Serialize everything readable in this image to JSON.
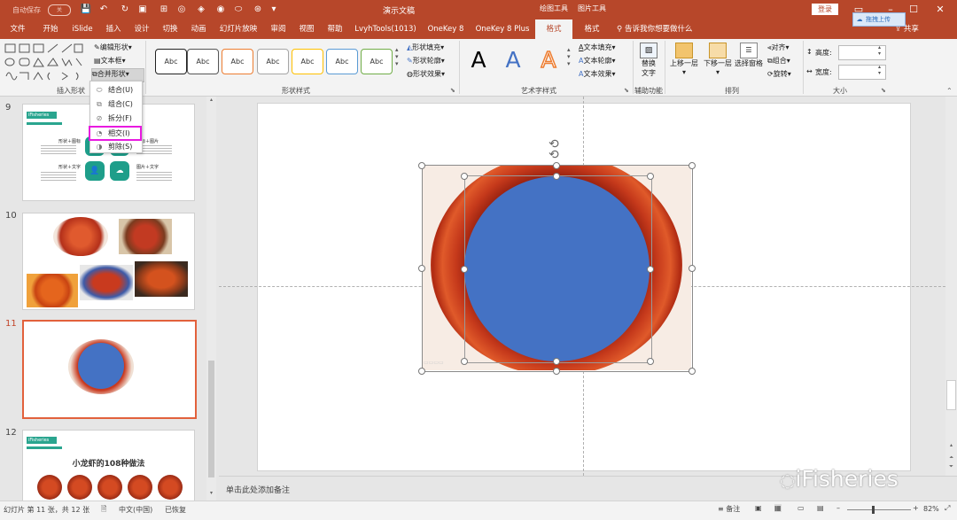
{
  "titlebar": {
    "autosave": "自动保存",
    "autosave_state": "关",
    "doc_title": "演示文稿",
    "ctx_drawing": "绘图工具",
    "ctx_picture": "图片工具",
    "login": "登录",
    "upload": "拖拽上传"
  },
  "tabs": [
    "文件",
    "开始",
    "iSlide",
    "插入",
    "设计",
    "切换",
    "动画",
    "幻灯片放映",
    "审阅",
    "视图",
    "帮助",
    "LvyhTools(1013)",
    "OneKey 8",
    "OneKey 8 Plus",
    "格式",
    "格式"
  ],
  "tell_me": "告诉我你想要做什么",
  "share": "共享",
  "ribbon": {
    "insert_shapes": {
      "edit_shape": "编辑形状",
      "text_box": "文本框",
      "merge_shapes": "合并形状",
      "label": "插入形状"
    },
    "shape_styles": {
      "sample": "Abc",
      "fill": "形状填充",
      "outline": "形状轮廓",
      "effects": "形状效果",
      "label": "形状样式"
    },
    "wordart": {
      "letter": "A",
      "text_fill": "文本填充",
      "text_outline": "文本轮廓",
      "text_effects": "文本效果",
      "label": "艺术字样式"
    },
    "accessibility": {
      "alt_text_1": "替换",
      "alt_text_2": "文字",
      "label": "辅助功能"
    },
    "arrange": {
      "bring_forward": "上移一层",
      "send_backward": "下移一层",
      "selection_pane": "选择窗格",
      "align": "对齐",
      "group": "组合",
      "rotate": "旋转",
      "label": "排列"
    },
    "size": {
      "height": "高度:",
      "width": "宽度:",
      "label": "大小"
    }
  },
  "merge_menu": [
    "结合(U)",
    "组合(C)",
    "拆分(F)",
    "相交(I)",
    "剪除(S)"
  ],
  "highlight_color": "#e81ae0",
  "style_colors": [
    "#222222",
    "#555555",
    "#ed7d31",
    "#a5a5a5",
    "#ffc000",
    "#5b9bd5",
    "#70ad47"
  ],
  "wordart_colors": [
    "#000000",
    "#4472c4",
    "#ed7d31"
  ],
  "circle_color": "#4472c4",
  "accent_color": "#b7472a",
  "slides": [
    {
      "number": "9",
      "brand": "iFisheries",
      "items": [
        "形状＋图标",
        "图标＋图片",
        "形状＋文字",
        "图片＋文字"
      ]
    },
    {
      "number": "10"
    },
    {
      "number": "11"
    },
    {
      "number": "12",
      "brand": "iFisheries",
      "title": "小龙虾的108种做法"
    }
  ],
  "notes_placeholder": "单击此处添加备注",
  "status": {
    "slide_info": "幻灯片 第 11 张，共 12 张",
    "language": "中文(中国)",
    "recovered": "已恢复",
    "notes_btn": "备注",
    "zoom": "82%"
  },
  "watermark": "iFisheries"
}
